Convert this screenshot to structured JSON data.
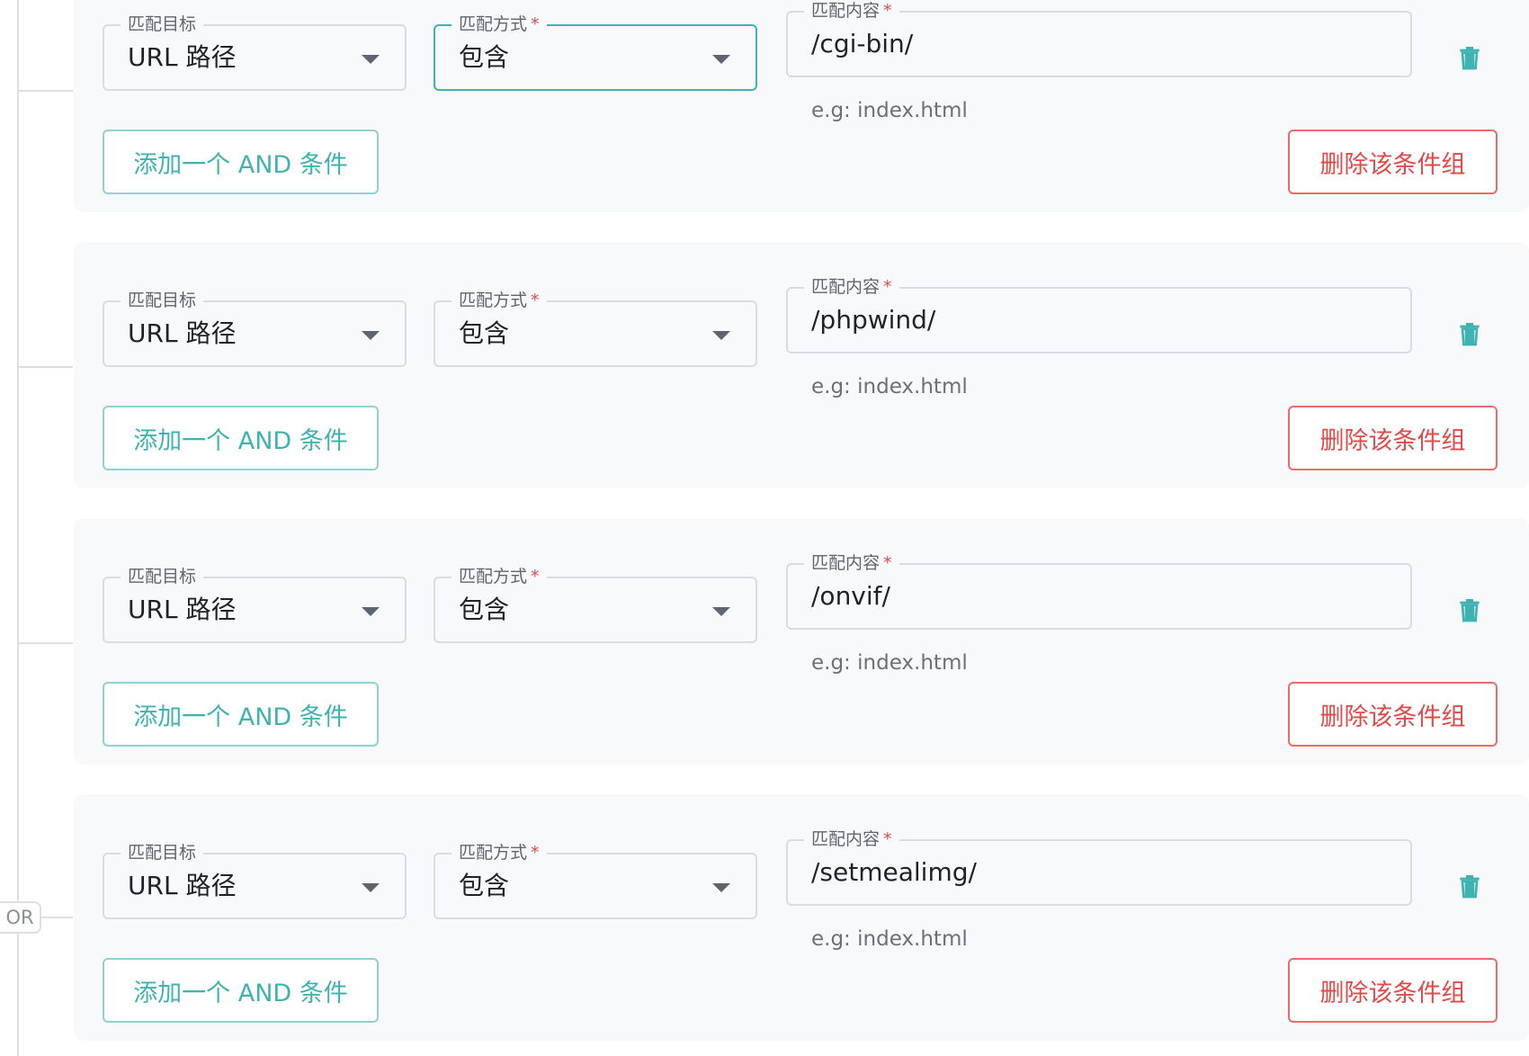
{
  "connector": {
    "or_label": "OR"
  },
  "groups": [
    {
      "target": {
        "label": "匹配目标",
        "value": "URL 路径"
      },
      "method": {
        "label": "匹配方式",
        "required_mark": "*",
        "value": "包含"
      },
      "content": {
        "label": "匹配内容",
        "required_mark": "*",
        "value": "/cgi-bin/",
        "hint": "e.g: index.html"
      },
      "add_and_button": "添加一个 AND 条件",
      "delete_group_button": "删除该条件组"
    },
    {
      "target": {
        "label": "匹配目标",
        "value": "URL 路径"
      },
      "method": {
        "label": "匹配方式",
        "required_mark": "*",
        "value": "包含"
      },
      "content": {
        "label": "匹配内容",
        "required_mark": "*",
        "value": "/phpwind/",
        "hint": "e.g: index.html"
      },
      "add_and_button": "添加一个 AND 条件",
      "delete_group_button": "删除该条件组"
    },
    {
      "target": {
        "label": "匹配目标",
        "value": "URL 路径"
      },
      "method": {
        "label": "匹配方式",
        "required_mark": "*",
        "value": "包含"
      },
      "content": {
        "label": "匹配内容",
        "required_mark": "*",
        "value": "/onvif/",
        "hint": "e.g: index.html"
      },
      "add_and_button": "添加一个 AND 条件",
      "delete_group_button": "删除该条件组"
    },
    {
      "target": {
        "label": "匹配目标",
        "value": "URL 路径"
      },
      "method": {
        "label": "匹配方式",
        "required_mark": "*",
        "value": "包含"
      },
      "content": {
        "label": "匹配内容",
        "required_mark": "*",
        "value": "/setmealimg/",
        "hint": "e.g: index.html"
      },
      "add_and_button": "添加一个 AND 条件",
      "delete_group_button": "删除该条件组"
    }
  ],
  "colors": {
    "accent": "#3fb3b1",
    "danger": "#e54848",
    "panel_bg": "#f8f9fb",
    "border": "#d9dce1"
  },
  "icons": {
    "delete_condition": "trash-icon",
    "dropdown": "chevron-down-icon"
  }
}
